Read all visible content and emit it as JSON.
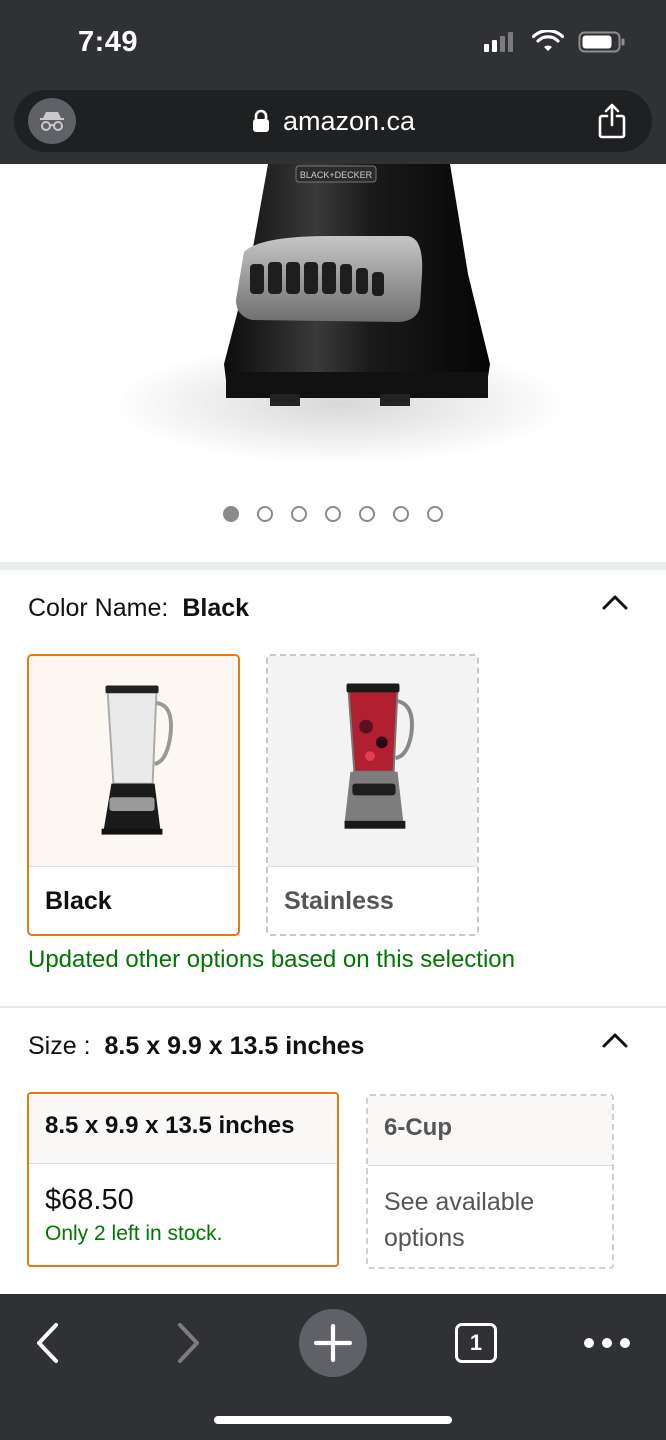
{
  "status_bar": {
    "time": "7:49"
  },
  "browser": {
    "url": "amazon.ca"
  },
  "product_image": {
    "brand_label": "BLACK+DECKER",
    "page_count": 7,
    "active_page": 0
  },
  "color": {
    "label": "Color Name:",
    "selected": "Black",
    "options": [
      {
        "label": "Black"
      },
      {
        "label": "Stainless"
      }
    ],
    "updated_message": "Updated other options based on this selection"
  },
  "size": {
    "label": "Size :",
    "selected": "8.5 x 9.9 x 13.5 inches",
    "options": [
      {
        "label": "8.5 x 9.9 x 13.5 inches",
        "price": "$68.50",
        "stock": "Only 2 left in stock."
      },
      {
        "label": "6-Cup",
        "note": "See available options"
      }
    ]
  },
  "toolbar": {
    "tab_count": "1"
  },
  "colors": {
    "chrome": "#303134",
    "selected_border": "#e47911",
    "in_stock_green": "#007600"
  }
}
